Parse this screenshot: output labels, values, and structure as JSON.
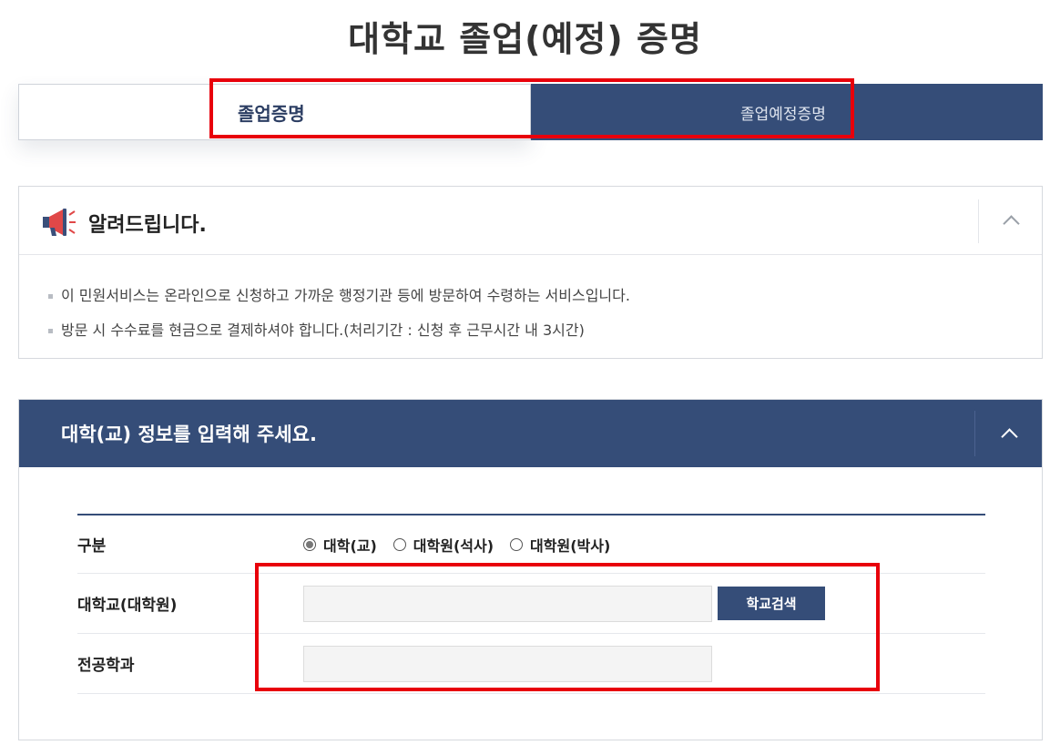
{
  "page": {
    "title": "대학교 졸업(예정) 증명"
  },
  "tabs": [
    {
      "label": "졸업증명",
      "active": true
    },
    {
      "label": "졸업예정증명",
      "active": false
    }
  ],
  "notice": {
    "title": "알려드립니다.",
    "icon": "megaphone-icon",
    "items": [
      "이 민원서비스는 온라인으로 신청하고 가까운 행정기관 등에 방문하여 수령하는 서비스입니다.",
      "방문 시 수수료를 현금으로 결제하셔야 합니다.(처리기간 : 신청 후 근무시간 내 3시간)"
    ]
  },
  "form": {
    "title": "대학(교) 정보를 입력해 주세요.",
    "rows": {
      "type": {
        "label": "구분",
        "options": [
          {
            "label": "대학(교)",
            "selected": true
          },
          {
            "label": "대학원(석사)",
            "selected": false
          },
          {
            "label": "대학원(박사)",
            "selected": false
          }
        ]
      },
      "university": {
        "label": "대학교(대학원)",
        "value": "",
        "button": "학교검색"
      },
      "major": {
        "label": "전공학과",
        "value": ""
      }
    }
  },
  "colors": {
    "primary": "#354d78",
    "highlight": "#e8000b",
    "input_bg": "#f4f4f4"
  }
}
